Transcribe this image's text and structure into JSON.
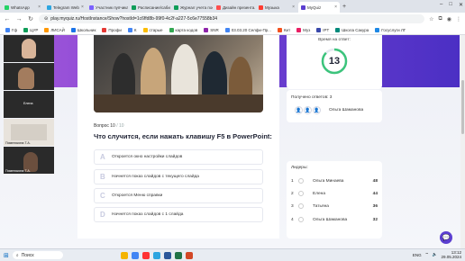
{
  "browser": {
    "tabs": [
      {
        "label": "WhatsApp",
        "color": "#25d366",
        "active": false
      },
      {
        "label": "Telegram Web",
        "color": "#2ca5e0",
        "active": false
      },
      {
        "label": "Участник пупчика...",
        "color": "#7b61ff",
        "active": false
      },
      {
        "label": "Расписание/саби...",
        "color": "#0f9d58",
        "active": false
      },
      {
        "label": "Журнал учета пос...",
        "color": "#0f9d58",
        "active": false
      },
      {
        "label": "Дизайн презента...",
        "color": "#ff4e4e",
        "active": false
      },
      {
        "label": "Музыка",
        "color": "#ff3b30",
        "active": false
      },
      {
        "label": "MyQuiz",
        "color": "#5b3fd0",
        "active": true
      }
    ],
    "new_tab": "+",
    "url": "play.myquiz.ru/HostInstance/Show?hostId=1c6ffd8b-99f0-4c2f-a227-5c6e77558b34",
    "bookmarks": [
      {
        "label": "Гф",
        "color": "#4285f4"
      },
      {
        "label": "ЦУР",
        "color": "#0f9d58"
      },
      {
        "label": "ЛИСАЙ",
        "color": "#ff9800"
      },
      {
        "label": "Школьник",
        "color": "#1a73e8"
      },
      {
        "label": "Профи",
        "color": "#e53935"
      },
      {
        "label": "К",
        "color": "#4285f4"
      },
      {
        "label": "старые",
        "color": "#fbbc04"
      },
      {
        "label": "карта кодов",
        "color": "#34a853"
      },
      {
        "label": "SNR",
        "color": "#8e24aa"
      },
      {
        "label": "03.03.20 Селфи-Пр...",
        "color": "#4285f4"
      },
      {
        "label": "Кит",
        "color": "#f4511e"
      },
      {
        "label": "Муз",
        "color": "#e91e63"
      },
      {
        "label": "IPT",
        "color": "#3949ab"
      },
      {
        "label": "Школа Сакура",
        "color": "#00897b"
      },
      {
        "label": "Госуслуги ЛГ",
        "color": "#1e88e5"
      }
    ]
  },
  "video": {
    "participants": [
      {
        "name": "",
        "bg": "#5c5a55"
      },
      {
        "name": "",
        "bg": "#7a6a5e"
      },
      {
        "name": "Елена",
        "bg": "#3c3c3c"
      },
      {
        "name": "Пименякина Т.А.",
        "bg": "#e8e3dc"
      },
      {
        "name": "Пименякина Т.А.",
        "bg": "#2b2b2b"
      }
    ]
  },
  "quiz": {
    "question_number": "Вопрос 10",
    "question_total": "/ 10",
    "question_text": "Что случится, если нажать клавишу F5 в PowerPoint:",
    "answers": [
      {
        "letter": "A",
        "text": "Откроется окно настройки слайдов"
      },
      {
        "letter": "B",
        "text": "Начнется показ слайдов с текущего слайда"
      },
      {
        "letter": "C",
        "text": "Откроется Меню справки"
      },
      {
        "letter": "D",
        "text": "Начнется показ слайдов с 1 слайда"
      }
    ]
  },
  "timer": {
    "label": "Время на ответ:",
    "value": "13",
    "fraction_remaining": 0.87
  },
  "answered": {
    "label": "Получено ответов: 3",
    "name": "Ольга Шаманова"
  },
  "leaders": {
    "label": "Лидеры:",
    "rows": [
      {
        "rank": "1",
        "name": "Ольга Минаева",
        "score": "48"
      },
      {
        "rank": "2",
        "name": "Елена",
        "score": "44"
      },
      {
        "rank": "3",
        "name": "Татьяна",
        "score": "36"
      },
      {
        "rank": "4",
        "name": "Ольга Шаманова",
        "score": "32"
      }
    ]
  },
  "taskbar": {
    "search_label": "Поиск",
    "lang": "ENG",
    "time": "13:12",
    "date": "29.05.2024",
    "apps": [
      {
        "name": "file-explorer-icon",
        "color": "#f4b400"
      },
      {
        "name": "chrome-icon",
        "color": "#4285f4"
      },
      {
        "name": "yandex-icon",
        "color": "#ff3333"
      },
      {
        "name": "telegram-icon",
        "color": "#2ca5e0"
      },
      {
        "name": "word-icon",
        "color": "#2b579a"
      },
      {
        "name": "excel-icon",
        "color": "#217346"
      },
      {
        "name": "powerpoint-icon",
        "color": "#d24726"
      }
    ]
  },
  "colors": {
    "accent": "#5b3fd0",
    "timer_ring": "#3cc47c"
  }
}
